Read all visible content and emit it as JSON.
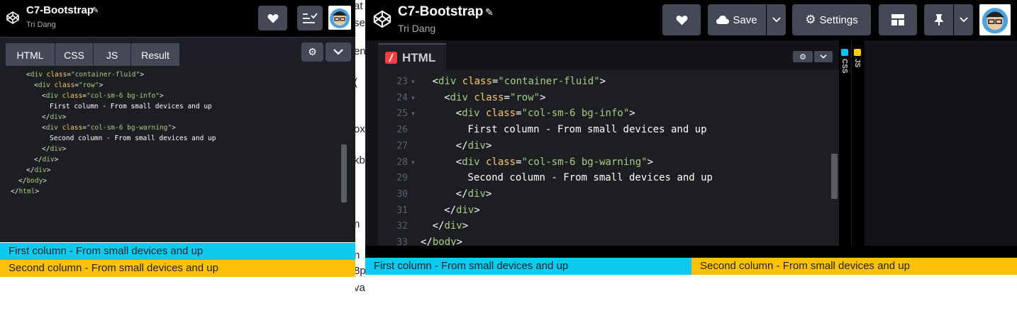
{
  "left": {
    "title": "C7-Bootstrap",
    "author": "Tri Dang",
    "tabs": [
      "HTML",
      "CSS",
      "JS",
      "Result"
    ],
    "code_lines": [
      {
        "indent": 4,
        "parts": [
          [
            "p",
            "<"
          ],
          [
            "t",
            "div"
          ],
          [
            "a",
            " class"
          ],
          [
            "p",
            "="
          ],
          [
            "s",
            "\"container-fluid\""
          ],
          [
            "p",
            ">"
          ]
        ]
      },
      {
        "indent": 6,
        "parts": [
          [
            "p",
            "<"
          ],
          [
            "t",
            "div"
          ],
          [
            "a",
            " class"
          ],
          [
            "p",
            "="
          ],
          [
            "s",
            "\"row\""
          ],
          [
            "p",
            ">"
          ]
        ]
      },
      {
        "indent": 8,
        "parts": [
          [
            "p",
            "<"
          ],
          [
            "t",
            "div"
          ],
          [
            "a",
            " class"
          ],
          [
            "p",
            "="
          ],
          [
            "s",
            "\"col-sm-6 bg-info\""
          ],
          [
            "p",
            ">"
          ]
        ]
      },
      {
        "indent": 10,
        "parts": [
          [
            "x",
            "First column - From small devices and up"
          ]
        ]
      },
      {
        "indent": 8,
        "parts": [
          [
            "p",
            "</"
          ],
          [
            "t",
            "div"
          ],
          [
            "p",
            ">"
          ]
        ]
      },
      {
        "indent": 8,
        "parts": [
          [
            "p",
            "<"
          ],
          [
            "t",
            "div"
          ],
          [
            "a",
            " class"
          ],
          [
            "p",
            "="
          ],
          [
            "s",
            "\"col-sm-6 bg-warning\""
          ],
          [
            "p",
            ">"
          ]
        ]
      },
      {
        "indent": 10,
        "parts": [
          [
            "x",
            "Second column - From small devices and up"
          ]
        ]
      },
      {
        "indent": 8,
        "parts": [
          [
            "p",
            "</"
          ],
          [
            "t",
            "div"
          ],
          [
            "p",
            ">"
          ]
        ]
      },
      {
        "indent": 6,
        "parts": [
          [
            "p",
            "</"
          ],
          [
            "t",
            "div"
          ],
          [
            "p",
            ">"
          ]
        ]
      },
      {
        "indent": 4,
        "parts": [
          [
            "p",
            "</"
          ],
          [
            "t",
            "div"
          ],
          [
            "p",
            ">"
          ]
        ]
      },
      {
        "indent": 2,
        "parts": [
          [
            "p",
            "</"
          ],
          [
            "t",
            "body"
          ],
          [
            "p",
            ">"
          ]
        ]
      },
      {
        "indent": 0,
        "parts": [
          [
            "p",
            "</"
          ],
          [
            "t",
            "html"
          ],
          [
            "p",
            ">"
          ]
        ]
      }
    ],
    "result": {
      "col1": "First column - From small devices and up",
      "col2": "Second column - From small devices and up"
    }
  },
  "right": {
    "title": "C7-Bootstrap",
    "author": "Tri Dang",
    "save_label": "Save",
    "settings_label": "Settings",
    "html_tab": "HTML",
    "css_label": "CSS",
    "js_label": "JS",
    "code_lines": [
      {
        "num": "23",
        "fold": true,
        "indent": 2,
        "parts": [
          [
            "p",
            "<"
          ],
          [
            "t",
            "div"
          ],
          [
            "a",
            " class"
          ],
          [
            "p",
            "="
          ],
          [
            "s",
            "\"container-fluid\""
          ],
          [
            "p",
            ">"
          ]
        ]
      },
      {
        "num": "24",
        "fold": true,
        "indent": 4,
        "parts": [
          [
            "p",
            "<"
          ],
          [
            "t",
            "div"
          ],
          [
            "a",
            " class"
          ],
          [
            "p",
            "="
          ],
          [
            "s",
            "\"row\""
          ],
          [
            "p",
            ">"
          ]
        ]
      },
      {
        "num": "25",
        "fold": true,
        "indent": 6,
        "parts": [
          [
            "p",
            "<"
          ],
          [
            "t",
            "div"
          ],
          [
            "a",
            " class"
          ],
          [
            "p",
            "="
          ],
          [
            "s",
            "\"col-sm-6 bg-info\""
          ],
          [
            "p",
            ">"
          ]
        ]
      },
      {
        "num": "26",
        "fold": false,
        "indent": 8,
        "parts": [
          [
            "x",
            "First column - From small devices and up"
          ]
        ]
      },
      {
        "num": "27",
        "fold": false,
        "indent": 6,
        "parts": [
          [
            "p",
            "</"
          ],
          [
            "t",
            "div"
          ],
          [
            "p",
            ">"
          ]
        ]
      },
      {
        "num": "28",
        "fold": true,
        "indent": 6,
        "parts": [
          [
            "p",
            "<"
          ],
          [
            "t",
            "div"
          ],
          [
            "a",
            " class"
          ],
          [
            "p",
            "="
          ],
          [
            "s",
            "\"col-sm-6 bg-warning\""
          ],
          [
            "p",
            ">"
          ]
        ]
      },
      {
        "num": "29",
        "fold": false,
        "indent": 8,
        "parts": [
          [
            "x",
            "Second column - From small devices and up"
          ]
        ]
      },
      {
        "num": "30",
        "fold": false,
        "indent": 6,
        "parts": [
          [
            "p",
            "</"
          ],
          [
            "t",
            "div"
          ],
          [
            "p",
            ">"
          ]
        ]
      },
      {
        "num": "31",
        "fold": false,
        "indent": 4,
        "parts": [
          [
            "p",
            "</"
          ],
          [
            "t",
            "div"
          ],
          [
            "p",
            ">"
          ]
        ]
      },
      {
        "num": "32",
        "fold": false,
        "indent": 2,
        "parts": [
          [
            "p",
            "</"
          ],
          [
            "t",
            "div"
          ],
          [
            "p",
            ">"
          ]
        ]
      },
      {
        "num": "33",
        "fold": false,
        "indent": 0,
        "parts": [
          [
            "p",
            "</"
          ],
          [
            "t",
            "body"
          ],
          [
            "p",
            ">"
          ]
        ]
      }
    ],
    "result": {
      "col1": "First column - From small devices and up",
      "col2": "Second column - From small devices and up"
    }
  },
  "background_fragments": [
    "at",
    "se",
    "en",
    "(",
    "ox",
    "kb",
    "n",
    "n",
    "8p",
    "va"
  ],
  "colors": {
    "info": "#0dcaf0",
    "warning": "#ffc107",
    "editor_bg": "#1d1e22",
    "button_bg": "#444857",
    "css_badge": "#0ebeff",
    "js_badge": "#fcd000",
    "html_badge": "#ff3c41"
  }
}
